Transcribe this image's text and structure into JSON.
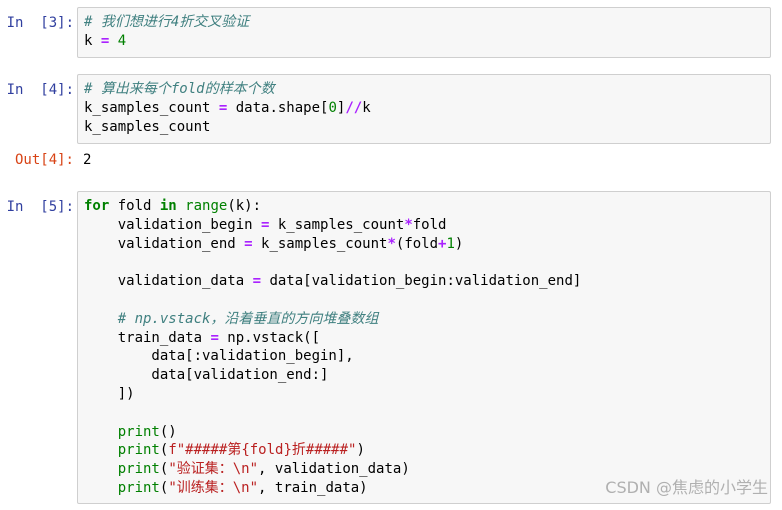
{
  "cells": [
    {
      "prompt": "In  [3]:",
      "lines": [
        [
          [
            "cm",
            "# 我们想进行4折交叉验证"
          ]
        ],
        [
          [
            "",
            "k "
          ],
          [
            "op",
            "="
          ],
          [
            "",
            " "
          ],
          [
            "num",
            "4"
          ]
        ]
      ]
    },
    {
      "prompt": "In  [4]:",
      "lines": [
        [
          [
            "cm",
            "# 算出来每个fold的样本个数"
          ]
        ],
        [
          [
            "",
            "k_samples_count "
          ],
          [
            "op",
            "="
          ],
          [
            "",
            " data.shape["
          ],
          [
            "num",
            "0"
          ],
          [
            "",
            "]"
          ],
          [
            "op",
            "//"
          ],
          [
            "",
            "k"
          ]
        ],
        [
          [
            "",
            "k_samples_count"
          ]
        ]
      ]
    },
    {
      "prompt": "In  [5]:",
      "lines": [
        [
          [
            "kw",
            "for"
          ],
          [
            "",
            " fold "
          ],
          [
            "kw",
            "in"
          ],
          [
            "",
            " "
          ],
          [
            "bi",
            "range"
          ],
          [
            "",
            "(k):"
          ]
        ],
        [
          [
            "",
            "    validation_begin "
          ],
          [
            "op",
            "="
          ],
          [
            "",
            " k_samples_count"
          ],
          [
            "op",
            "*"
          ],
          [
            "",
            "fold"
          ]
        ],
        [
          [
            "",
            "    validation_end "
          ],
          [
            "op",
            "="
          ],
          [
            "",
            " k_samples_count"
          ],
          [
            "op",
            "*"
          ],
          [
            "",
            "(fold"
          ],
          [
            "op",
            "+"
          ],
          [
            "num",
            "1"
          ],
          [
            "",
            ")"
          ]
        ],
        [
          [
            "",
            ""
          ]
        ],
        [
          [
            "",
            "    validation_data "
          ],
          [
            "op",
            "="
          ],
          [
            "",
            " data[validation_begin:validation_end]"
          ]
        ],
        [
          [
            "",
            ""
          ]
        ],
        [
          [
            "",
            "    "
          ],
          [
            "cm",
            "# np.vstack，沿着垂直的方向堆叠数组"
          ]
        ],
        [
          [
            "",
            "    train_data "
          ],
          [
            "op",
            "="
          ],
          [
            "",
            " np.vstack(["
          ]
        ],
        [
          [
            "",
            "        data[:validation_begin],"
          ]
        ],
        [
          [
            "",
            "        data[validation_end:]"
          ]
        ],
        [
          [
            "",
            "    ])"
          ]
        ],
        [
          [
            "",
            ""
          ]
        ],
        [
          [
            "",
            "    "
          ],
          [
            "bi",
            "print"
          ],
          [
            "",
            "()"
          ]
        ],
        [
          [
            "",
            "    "
          ],
          [
            "bi",
            "print"
          ],
          [
            "",
            "("
          ],
          [
            "str",
            "f\"#####第{fold}折#####\""
          ],
          [
            "",
            ")"
          ]
        ],
        [
          [
            "",
            "    "
          ],
          [
            "bi",
            "print"
          ],
          [
            "",
            "("
          ],
          [
            "str",
            "\"验证集：\\n\""
          ],
          [
            "",
            ", validation_data)"
          ]
        ],
        [
          [
            "",
            "    "
          ],
          [
            "bi",
            "print"
          ],
          [
            "",
            "("
          ],
          [
            "str",
            "\"训练集：\\n\""
          ],
          [
            "",
            ", train_data)"
          ]
        ]
      ]
    }
  ],
  "output": {
    "prompt": "Out[4]:",
    "value": "2"
  },
  "watermark": "CSDN @焦虑的小学生"
}
